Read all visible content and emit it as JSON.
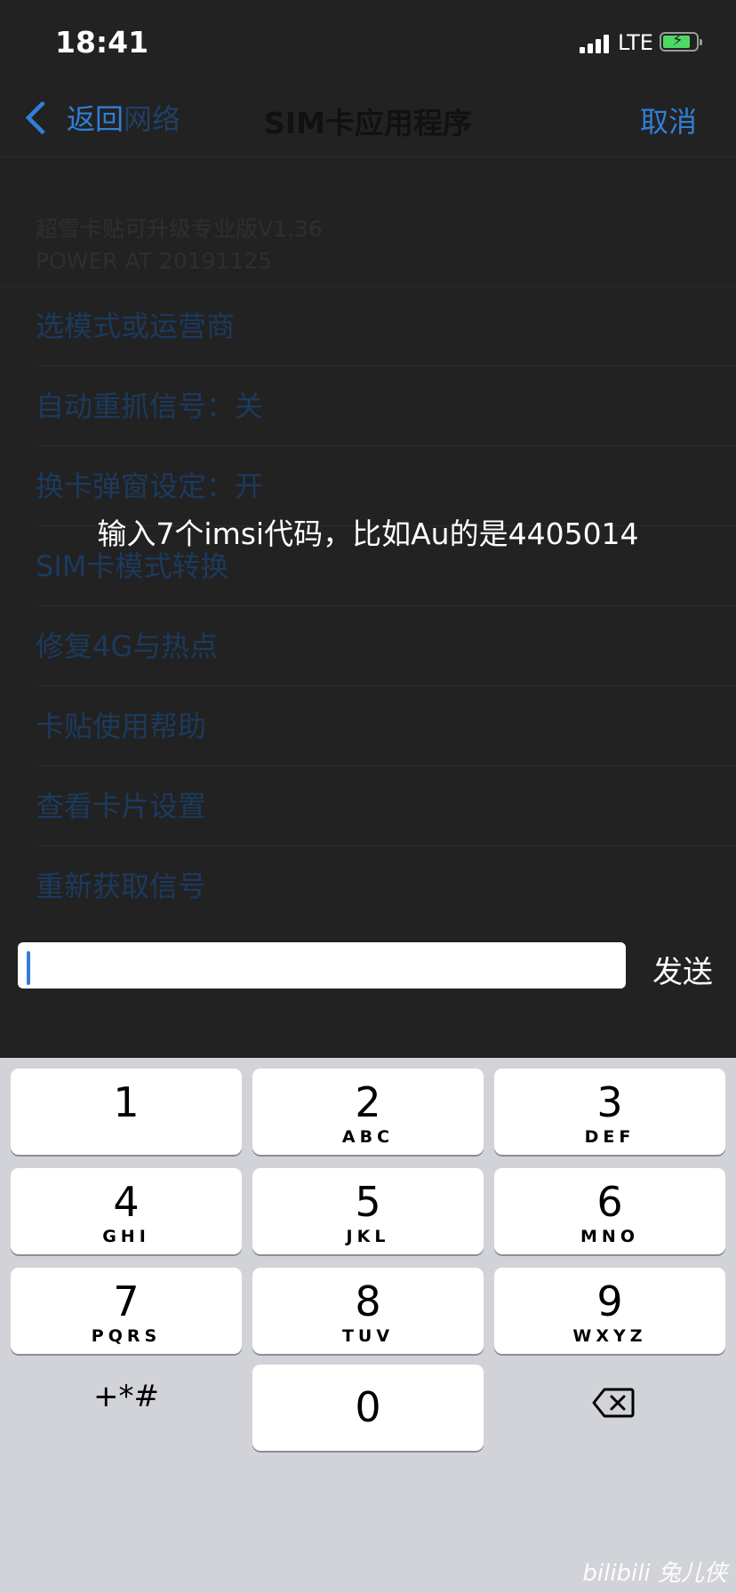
{
  "status_bar": {
    "time": "18:41",
    "network": "LTE",
    "battery_color": "#4cd964"
  },
  "nav": {
    "back_label": "返回",
    "back_label_faded": "网络",
    "title": "SIM卡应用程序",
    "cancel_label": "取消"
  },
  "header": {
    "line1": "超雪卡贴可升级专业版V1.36",
    "line2": "POWER AT 20191125"
  },
  "menu": {
    "items": [
      {
        "label": "选模式或运营商"
      },
      {
        "label": "自动重抓信号：关"
      },
      {
        "label": "换卡弹窗设定：开"
      },
      {
        "label": "SIM卡模式转换"
      },
      {
        "label": "修复4G与热点"
      },
      {
        "label": "卡贴使用帮助"
      },
      {
        "label": "查看卡片设置"
      },
      {
        "label": "重新获取信号"
      }
    ]
  },
  "prompt": {
    "text": "输入7个imsi代码，比如Au的是4405014"
  },
  "input": {
    "value": "",
    "send_label": "发送"
  },
  "keyboard": {
    "keys": [
      {
        "num": "1",
        "letters": ""
      },
      {
        "num": "2",
        "letters": "ABC"
      },
      {
        "num": "3",
        "letters": "DEF"
      },
      {
        "num": "4",
        "letters": "GHI"
      },
      {
        "num": "5",
        "letters": "JKL"
      },
      {
        "num": "6",
        "letters": "MNO"
      },
      {
        "num": "7",
        "letters": "PQRS"
      },
      {
        "num": "8",
        "letters": "TUV"
      },
      {
        "num": "9",
        "letters": "WXYZ"
      },
      {
        "num": "0",
        "letters": ""
      }
    ],
    "symbols_label": "+*#",
    "delete_icon": "backspace-icon"
  },
  "watermark": {
    "text": "bilibili 兔儿侠"
  },
  "colors": {
    "accent": "#2f7fd6",
    "background": "#222222",
    "keyboard_bg": "#d1d3d8"
  }
}
